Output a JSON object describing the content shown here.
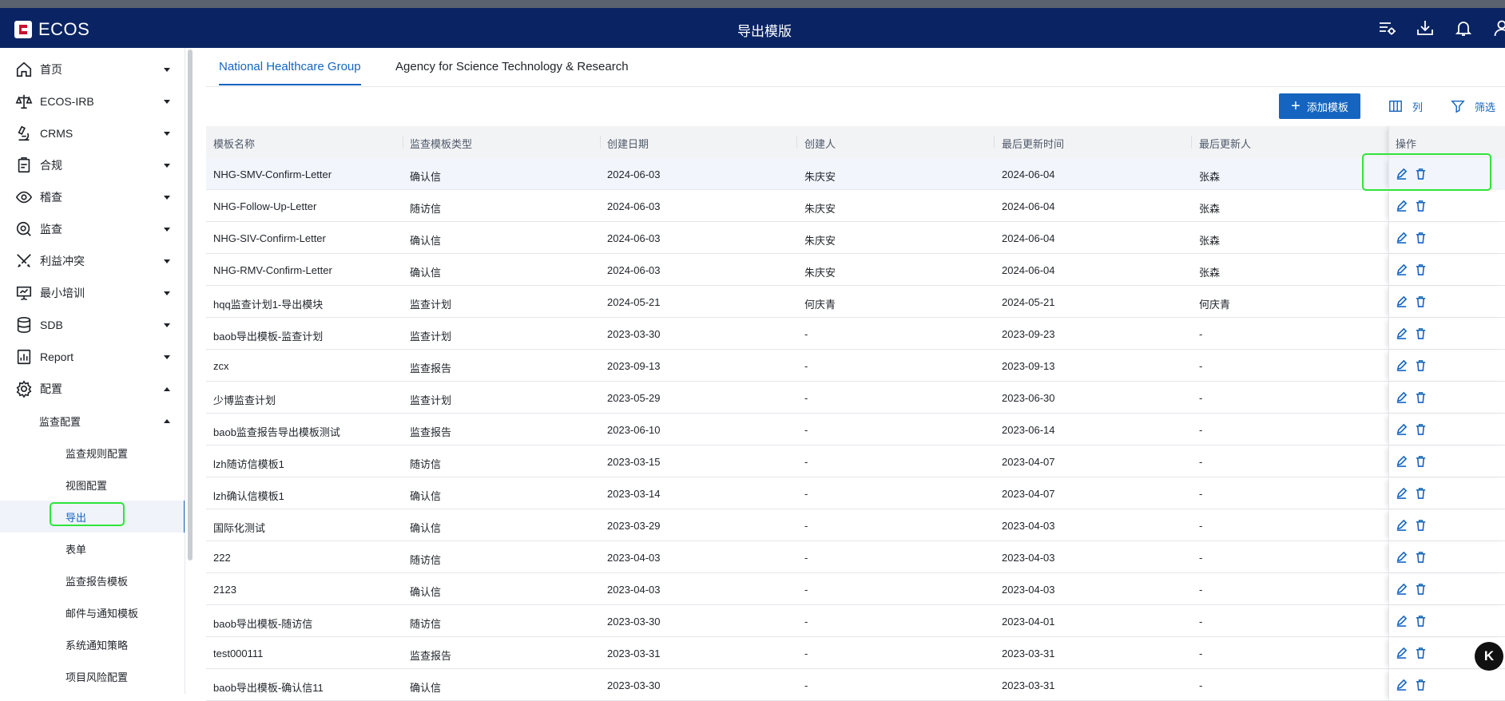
{
  "app": {
    "logo_text": "ECOS",
    "title": "导出模版"
  },
  "header_icons": [
    "list-settings-icon",
    "download-icon",
    "bell-icon",
    "user-icon"
  ],
  "sidebar": {
    "items": [
      {
        "label": "首页",
        "icon": "home-icon"
      },
      {
        "label": "ECOS-IRB",
        "icon": "scale-icon"
      },
      {
        "label": "CRMS",
        "icon": "microscope-icon"
      },
      {
        "label": "合规",
        "icon": "clipboard-icon"
      },
      {
        "label": "稽查",
        "icon": "eye-icon"
      },
      {
        "label": "监查",
        "icon": "search-eye-icon"
      },
      {
        "label": "利益冲突",
        "icon": "swords-icon"
      },
      {
        "label": "最小培训",
        "icon": "presentation-icon"
      },
      {
        "label": "SDB",
        "icon": "database-icon"
      },
      {
        "label": "Report",
        "icon": "report-icon"
      },
      {
        "label": "配置",
        "icon": "gear-icon"
      }
    ],
    "sub_group": "监查配置",
    "leaves": [
      "监查规则配置",
      "视图配置",
      "导出",
      "表单",
      "监查报告模板",
      "邮件与通知模板",
      "系统通知策略",
      "项目风险配置"
    ],
    "active_leaf": "导出"
  },
  "tabs": [
    "National Healthcare Group",
    "Agency for Science Technology & Research"
  ],
  "toolbar": {
    "add_label": "添加模板",
    "columns_label": "列",
    "filter_label": "筛选"
  },
  "table": {
    "headers": [
      "模板名称",
      "监查模板类型",
      "创建日期",
      "创建人",
      "最后更新时间",
      "最后更新人",
      "操作"
    ],
    "rows": [
      [
        "NHG-SMV-Confirm-Letter",
        "确认信",
        "2024-06-03",
        "朱庆安",
        "2024-06-04",
        "张森"
      ],
      [
        "NHG-Follow-Up-Letter",
        "随访信",
        "2024-06-03",
        "朱庆安",
        "2024-06-04",
        "张森"
      ],
      [
        "NHG-SIV-Confirm-Letter",
        "确认信",
        "2024-06-03",
        "朱庆安",
        "2024-06-04",
        "张森"
      ],
      [
        "NHG-RMV-Confirm-Letter",
        "确认信",
        "2024-06-03",
        "朱庆安",
        "2024-06-04",
        "张森"
      ],
      [
        "hqq监查计划1-导出模块",
        "监查计划",
        "2024-05-21",
        "何庆青",
        "2024-05-21",
        "何庆青"
      ],
      [
        "baob导出模板-监查计划",
        "监查计划",
        "2023-03-30",
        "-",
        "2023-09-23",
        "-"
      ],
      [
        "zcx",
        "监查报告",
        "2023-09-13",
        "-",
        "2023-09-13",
        "-"
      ],
      [
        "少博监查计划",
        "监查计划",
        "2023-05-29",
        "-",
        "2023-06-30",
        "-"
      ],
      [
        "baob监查报告导出模板测试",
        "监查报告",
        "2023-06-10",
        "-",
        "2023-06-14",
        "-"
      ],
      [
        "lzh随访信模板1",
        "随访信",
        "2023-03-15",
        "-",
        "2023-04-07",
        "-"
      ],
      [
        "lzh确认信模板1",
        "确认信",
        "2023-03-14",
        "-",
        "2023-04-07",
        "-"
      ],
      [
        "国际化测试",
        "确认信",
        "2023-03-29",
        "-",
        "2023-04-03",
        "-"
      ],
      [
        "222",
        "随访信",
        "2023-04-03",
        "-",
        "2023-04-03",
        "-"
      ],
      [
        "2123",
        "确认信",
        "2023-04-03",
        "-",
        "2023-04-03",
        "-"
      ],
      [
        "baob导出模板-随访信",
        "随访信",
        "2023-03-30",
        "-",
        "2023-04-01",
        "-"
      ],
      [
        "test000111",
        "监查报告",
        "2023-03-31",
        "-",
        "2023-03-31",
        "-"
      ],
      [
        "baob导出模板-确认信11",
        "确认信",
        "2023-03-30",
        "-",
        "2023-03-31",
        "-"
      ]
    ]
  },
  "floating_button": {
    "label": "K"
  },
  "colors": {
    "header_bg": "#0a2463",
    "accent": "#1565c0",
    "highlight": "#2ee53a"
  }
}
